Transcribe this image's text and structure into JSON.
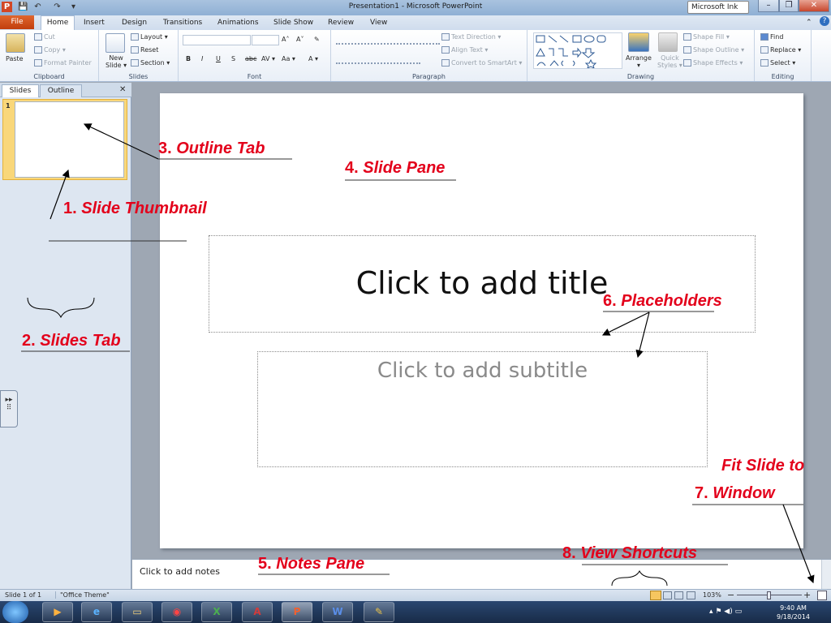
{
  "window": {
    "title": "Presentation1 - Microsoft PowerPoint",
    "ink_button": "Microsoft Ink",
    "minimize": "–",
    "restore": "❐",
    "close": "✕"
  },
  "qat": {
    "app_icon": "P",
    "save": "💾",
    "undo": "↶",
    "redo": "↷",
    "customize": "▾"
  },
  "tabs": [
    "File",
    "Home",
    "Insert",
    "Design",
    "Transitions",
    "Animations",
    "Slide Show",
    "Review",
    "View"
  ],
  "ribbon_help": [
    "⌃",
    "?"
  ],
  "ribbon": {
    "clipboard": {
      "label": "Clipboard",
      "paste": "Paste",
      "cut": "Cut",
      "copy": "Copy ▾",
      "format_painter": "Format Painter"
    },
    "slides": {
      "label": "Slides",
      "new_slide": "New Slide ▾",
      "new_slide_line1": "New",
      "new_slide_line2": "Slide ▾",
      "layout": "Layout ▾",
      "reset": "Reset",
      "section": "Section ▾"
    },
    "font": {
      "label": "Font",
      "grow": "A˄",
      "shrink": "A˅",
      "clear": "✎",
      "bold": "B",
      "italic": "I",
      "underline": "U",
      "shadow": "S",
      "strike": "abc",
      "spacing": "AV ▾",
      "case": "Aa ▾",
      "color": "A ▾"
    },
    "paragraph": {
      "label": "Paragraph",
      "text_direction": "Text Direction ▾",
      "align_text": "Align Text ▾",
      "smartart": "Convert to SmartArt ▾"
    },
    "drawing": {
      "label": "Drawing",
      "arrange": "Arrange",
      "arrange_caret": "▾",
      "quick_styles": "Quick Styles ▾",
      "quick_line1": "Quick",
      "quick_line2": "Styles ▾",
      "shape_fill": "Shape Fill ▾",
      "shape_outline": "Shape Outline ▾",
      "shape_effects": "Shape Effects ▾"
    },
    "editing": {
      "label": "Editing",
      "find": "Find",
      "replace": "Replace ▾",
      "select": "Select ▾"
    }
  },
  "left_pane": {
    "tabs": [
      "Slides",
      "Outline"
    ],
    "close": "✕",
    "thumb_number": "1"
  },
  "slide": {
    "title_placeholder": "Click to add title",
    "subtitle_placeholder": "Click to add subtitle"
  },
  "notes": {
    "placeholder": "Click to add notes"
  },
  "status": {
    "slide": "Slide 1 of 1",
    "theme": "\"Office Theme\"",
    "zoom": "103%",
    "zoom_minus": "−",
    "zoom_plus": "+"
  },
  "taskbar": {
    "time": "9:40 AM",
    "date": "9/18/2014"
  },
  "annotations": {
    "a1": {
      "num": "1.",
      "text": "Slide Thumbnail"
    },
    "a2": {
      "num": "2.",
      "text": "Slides Tab"
    },
    "a3": {
      "num": "3.",
      "text": "Outline Tab"
    },
    "a4": {
      "num": "4.",
      "text": "Slide Pane"
    },
    "a5": {
      "num": "5.",
      "text": "Notes Pane"
    },
    "a6": {
      "num": "6.",
      "text": "Placeholders"
    },
    "a7": {
      "num": "7.",
      "line1": "Fit Slide to",
      "line2": "Window"
    },
    "a8": {
      "num": "8.",
      "text": "View Shortcuts"
    }
  },
  "colors": {
    "annotation": "#e3001b",
    "file_tab": "#c84313",
    "thumbnail_highlight": "#f9d77a"
  },
  "icons": [
    "powerpoint-app-icon",
    "save-icon",
    "undo-icon",
    "redo-icon",
    "paste-icon",
    "cut-icon",
    "copy-icon",
    "format-painter-icon",
    "new-slide-icon",
    "find-icon",
    "replace-icon",
    "select-icon",
    "fit-to-window-icon",
    "start-orb-icon",
    "media-player-icon",
    "ie-icon",
    "explorer-icon",
    "chrome-icon",
    "excel-icon",
    "access-icon",
    "powerpoint-icon",
    "word-icon",
    "pen-icon"
  ]
}
